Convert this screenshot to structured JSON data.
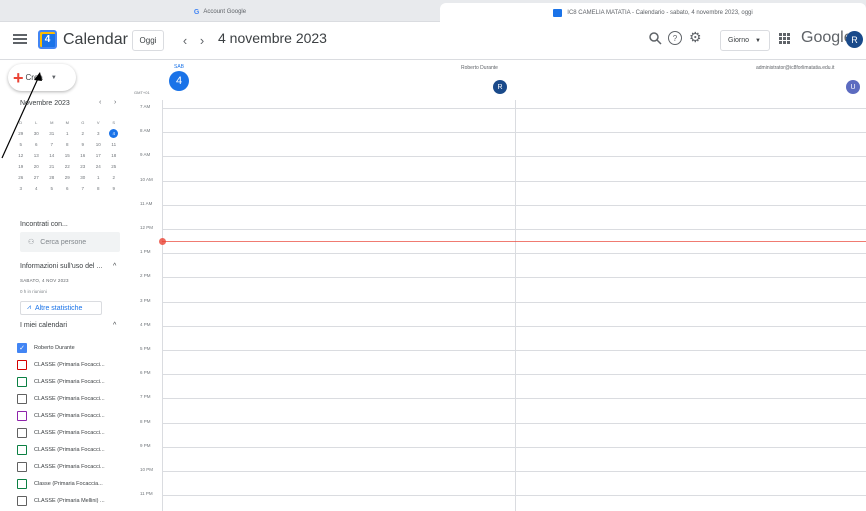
{
  "browser": {
    "tab_1": "Account Google",
    "tab_2": "IC8 CAMELIA MATATIA - Calendario - sabato, 4 novembre 2023, oggi"
  },
  "header": {
    "app_title": "Calendar",
    "logo_number": "4",
    "today_label": "Oggi",
    "prev_glyph": "‹",
    "next_glyph": "›",
    "date_title": "4 novembre 2023",
    "view_label": "Giorno",
    "google_word": "Google",
    "account_initial": "R"
  },
  "create": {
    "label": "Crea"
  },
  "mini_calendar": {
    "month_label": "Novembre 2023",
    "prev_glyph": "‹",
    "next_glyph": "›",
    "weekday_headers": [
      "D",
      "L",
      "M",
      "M",
      "G",
      "V",
      "S"
    ],
    "weeks": [
      [
        "29",
        "30",
        "31",
        "1",
        "2",
        "3",
        "4"
      ],
      [
        "5",
        "6",
        "7",
        "8",
        "9",
        "10",
        "11"
      ],
      [
        "12",
        "13",
        "14",
        "15",
        "16",
        "17",
        "18"
      ],
      [
        "19",
        "20",
        "21",
        "22",
        "23",
        "24",
        "25"
      ],
      [
        "26",
        "27",
        "28",
        "29",
        "30",
        "1",
        "2"
      ],
      [
        "3",
        "4",
        "5",
        "6",
        "7",
        "8",
        "9"
      ]
    ],
    "current_day": "4"
  },
  "sidebar": {
    "meet_label": "Incontrati con...",
    "search_people_placeholder": "Cerca persone",
    "info_header": "Informazioni sull'uso del ...",
    "info_date": "SABATO, 4 NOV 2023",
    "info_sub": "0 h in riunioni",
    "stats_label": "Altre statistiche",
    "my_calendars_label": "I miei calendari",
    "calendars": [
      {
        "name": "Roberto Durante",
        "checked": true,
        "color": "#4285f4"
      },
      {
        "name": "CLASSE (Primaria Focacci...",
        "checked": false,
        "color": "#d50000"
      },
      {
        "name": "CLASSE (Primaria Focacci...",
        "checked": false,
        "color": "#0b8043"
      },
      {
        "name": "CLASSE (Primaria Focacci...",
        "checked": false,
        "color": "#616161"
      },
      {
        "name": "CLASSE (Primaria Focacci...",
        "checked": false,
        "color": "#8e24aa"
      },
      {
        "name": "CLASSE (Primaria Focacci...",
        "checked": false,
        "color": "#616161"
      },
      {
        "name": "CLASSE (Primaria Focacci...",
        "checked": false,
        "color": "#0b8043"
      },
      {
        "name": "CLASSE (Primaria Focacci...",
        "checked": false,
        "color": "#616161"
      },
      {
        "name": "Classe (Primaria Focaccia...",
        "checked": false,
        "color": "#0b8043"
      },
      {
        "name": "CLASSE (Primaria Mellini) ...",
        "checked": false,
        "color": "#616161"
      }
    ]
  },
  "day_view": {
    "dow": "SAB",
    "day_number": "4",
    "timezone": "GMT+01",
    "columns": [
      {
        "name": "Roberto Durante",
        "initial": "R",
        "color": "#1a4a8a"
      },
      {
        "name": "administrator@ic8forlimatatia.edu.it",
        "initial": "U",
        "color": "#5c6bc0"
      }
    ],
    "hours": [
      "7 AM",
      "8 AM",
      "9 AM",
      "10 AM",
      "11 AM",
      "12 PM",
      "1 PM",
      "2 PM",
      "3 PM",
      "4 PM",
      "5 PM",
      "6 PM",
      "7 PM",
      "8 PM",
      "9 PM",
      "10 PM",
      "11 PM"
    ]
  },
  "colors": {
    "accent": "#1a73e8",
    "now_line": "#ea4335"
  }
}
